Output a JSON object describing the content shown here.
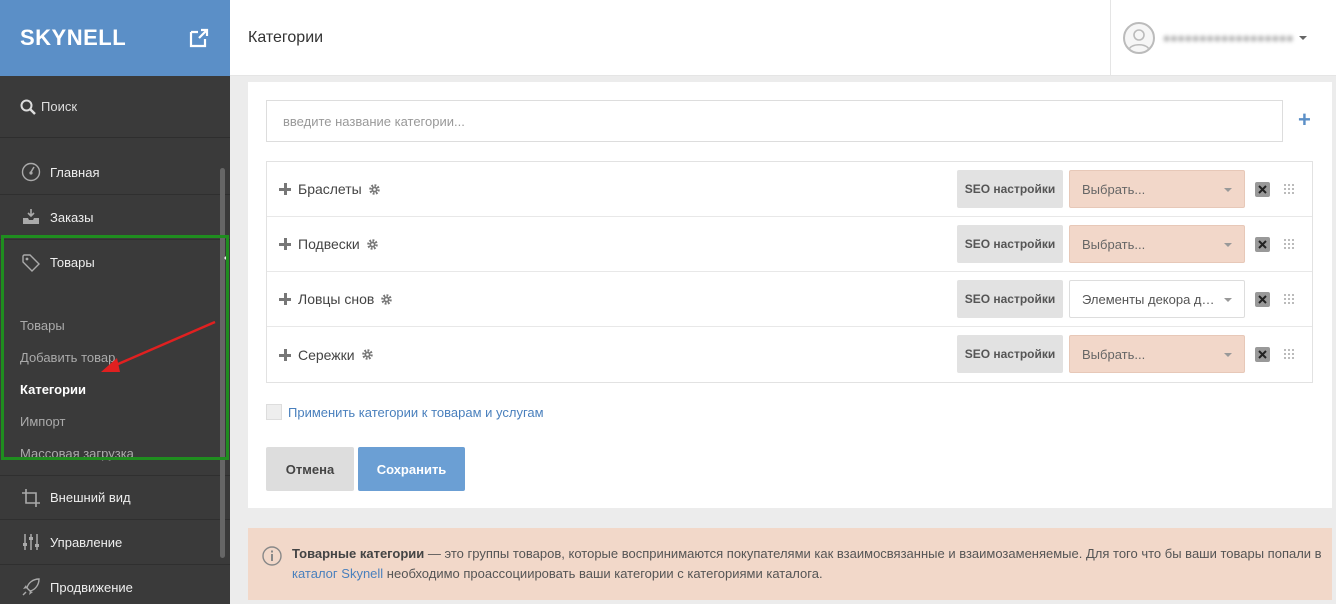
{
  "app": {
    "logo": "SKYNELL"
  },
  "header": {
    "title": "Категории"
  },
  "sidebar": {
    "search_label": "Поиск",
    "items_top": [
      {
        "label": "Главная",
        "icon": "dashboard-icon"
      },
      {
        "label": "Заказы",
        "icon": "inbox-icon"
      },
      {
        "label": "Товары",
        "icon": "tag-icon"
      }
    ],
    "sub_items": [
      {
        "label": "Товары"
      },
      {
        "label": "Добавить товар"
      },
      {
        "label": "Категории"
      },
      {
        "label": "Импорт"
      },
      {
        "label": "Массовая загрузка"
      }
    ],
    "items_bottom": [
      {
        "label": "Внешний вид",
        "icon": "crop-icon"
      },
      {
        "label": "Управление",
        "icon": "sliders-icon"
      },
      {
        "label": "Продвижение",
        "icon": "rocket-icon"
      }
    ]
  },
  "main": {
    "input_placeholder": "введите название категории...",
    "seo_label": "SEO настройки",
    "categories": [
      {
        "name": "Браслеты",
        "select": "Выбрать..."
      },
      {
        "name": "Подвески",
        "select": "Выбрать..."
      },
      {
        "name": "Ловцы снов",
        "select": "Элементы декора для дома"
      },
      {
        "name": "Сережки",
        "select": "Выбрать..."
      }
    ],
    "apply_label": "Применить категории к товарам и услугам",
    "cancel_label": "Отмена",
    "save_label": "Сохранить"
  },
  "info": {
    "bold": "Товарные категории",
    "text1": " — это группы товаров, которые воспринимаются покупателями как взаимосвязанные и взаимозаменяемые. Для того что бы ваши товары попали в ",
    "link": "каталог Skynell",
    "text2": " необходимо проассоциировать ваши категории с категориями каталога."
  },
  "colors": {
    "accent": "#5b8fc7",
    "sidebar": "#3a3a3a",
    "highlight_box": "#1f8d1f",
    "select_empty": "#f2d7c9",
    "arrow": "#e02020"
  }
}
